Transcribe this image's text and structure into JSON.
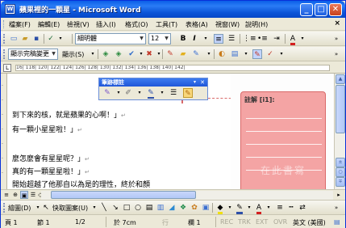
{
  "window": {
    "title": "蘋果裡的一顆星 - Microsoft Word",
    "app_icon": "W",
    "controls": {
      "minimize": "_",
      "maximize": "□",
      "close": "✕"
    }
  },
  "menubar": {
    "items": [
      "檔案(F)",
      "編輯(E)",
      "檢視(V)",
      "插入(I)",
      "格式(O)",
      "工具(T)",
      "表格(A)",
      "視窗(W)",
      "說明(H)"
    ],
    "close_doc": "×"
  },
  "toolbar_standard": {
    "font_name": "細明體",
    "font_size": "12",
    "bold": "B",
    "italic": "I"
  },
  "toolbar_reviewing": {
    "display_mode": "顯示完稿變更",
    "show_menu": "顯示(S)"
  },
  "ruler": {
    "tab_selector": "L",
    "ticks": "16|  118|  120|  122|  124|  126|  128|  130|  132|  134|  136|  138|  140|  142|"
  },
  "document": {
    "lines": [
      "到下來的核，就是蘋果的心啊！」",
      "有一顆小星星啦！」",
      "",
      "麼怎麼會有星星呢？」",
      "真的有一顆星星啦！」",
      "開始超越了他那自以為是的理性，終於和顏"
    ],
    "paragraph_mark": "↵"
  },
  "comment": {
    "label": "註解 [i1]:",
    "watermark": "在此書寫"
  },
  "handwriting_toolbar": {
    "title": "筆跡標註",
    "dropdown": "▾",
    "close": "✕"
  },
  "drawing_toolbar": {
    "draw_label": "繪圖(D)",
    "autoshape_label": "快取圖案(U)"
  },
  "statusbar": {
    "page": "頁 1",
    "section": "節 1",
    "page_of": "1/2",
    "position": "於 7cm",
    "line": "行",
    "column": "欄 1",
    "rec": "REC",
    "trk": "TRK",
    "ext": "EXT",
    "ovr": "OVR",
    "language": "英文 (美國)"
  },
  "colors": {
    "title_bar": "#0a5ee8",
    "comment_balloon": "#f4a4a4",
    "window_border": "#0831d9"
  }
}
